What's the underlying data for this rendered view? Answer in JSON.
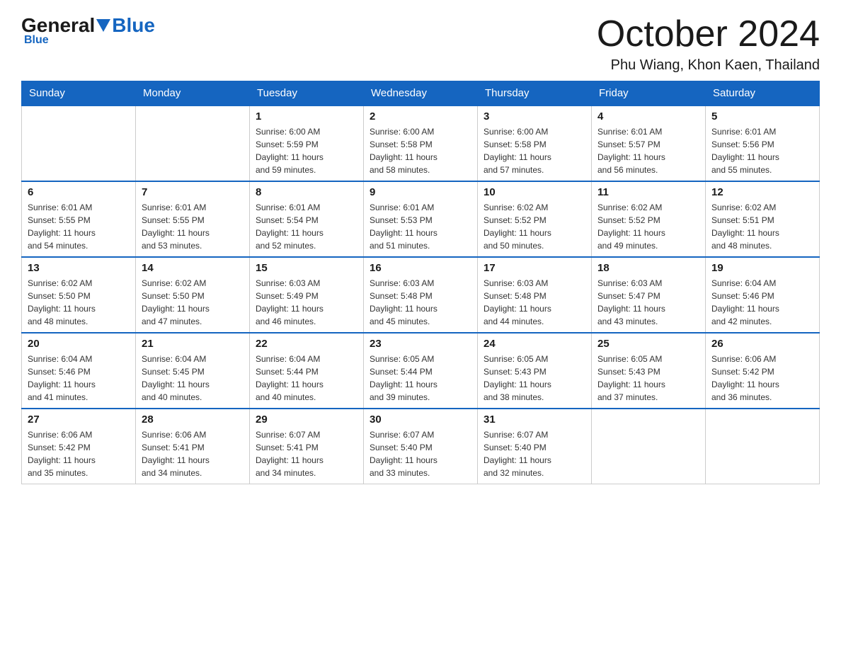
{
  "header": {
    "logo_general": "General",
    "logo_blue": "Blue",
    "title": "October 2024",
    "location": "Phu Wiang, Khon Kaen, Thailand"
  },
  "calendar": {
    "days_of_week": [
      "Sunday",
      "Monday",
      "Tuesday",
      "Wednesday",
      "Thursday",
      "Friday",
      "Saturday"
    ],
    "weeks": [
      [
        {
          "day": "",
          "info": ""
        },
        {
          "day": "",
          "info": ""
        },
        {
          "day": "1",
          "info": "Sunrise: 6:00 AM\nSunset: 5:59 PM\nDaylight: 11 hours\nand 59 minutes."
        },
        {
          "day": "2",
          "info": "Sunrise: 6:00 AM\nSunset: 5:58 PM\nDaylight: 11 hours\nand 58 minutes."
        },
        {
          "day": "3",
          "info": "Sunrise: 6:00 AM\nSunset: 5:58 PM\nDaylight: 11 hours\nand 57 minutes."
        },
        {
          "day": "4",
          "info": "Sunrise: 6:01 AM\nSunset: 5:57 PM\nDaylight: 11 hours\nand 56 minutes."
        },
        {
          "day": "5",
          "info": "Sunrise: 6:01 AM\nSunset: 5:56 PM\nDaylight: 11 hours\nand 55 minutes."
        }
      ],
      [
        {
          "day": "6",
          "info": "Sunrise: 6:01 AM\nSunset: 5:55 PM\nDaylight: 11 hours\nand 54 minutes."
        },
        {
          "day": "7",
          "info": "Sunrise: 6:01 AM\nSunset: 5:55 PM\nDaylight: 11 hours\nand 53 minutes."
        },
        {
          "day": "8",
          "info": "Sunrise: 6:01 AM\nSunset: 5:54 PM\nDaylight: 11 hours\nand 52 minutes."
        },
        {
          "day": "9",
          "info": "Sunrise: 6:01 AM\nSunset: 5:53 PM\nDaylight: 11 hours\nand 51 minutes."
        },
        {
          "day": "10",
          "info": "Sunrise: 6:02 AM\nSunset: 5:52 PM\nDaylight: 11 hours\nand 50 minutes."
        },
        {
          "day": "11",
          "info": "Sunrise: 6:02 AM\nSunset: 5:52 PM\nDaylight: 11 hours\nand 49 minutes."
        },
        {
          "day": "12",
          "info": "Sunrise: 6:02 AM\nSunset: 5:51 PM\nDaylight: 11 hours\nand 48 minutes."
        }
      ],
      [
        {
          "day": "13",
          "info": "Sunrise: 6:02 AM\nSunset: 5:50 PM\nDaylight: 11 hours\nand 48 minutes."
        },
        {
          "day": "14",
          "info": "Sunrise: 6:02 AM\nSunset: 5:50 PM\nDaylight: 11 hours\nand 47 minutes."
        },
        {
          "day": "15",
          "info": "Sunrise: 6:03 AM\nSunset: 5:49 PM\nDaylight: 11 hours\nand 46 minutes."
        },
        {
          "day": "16",
          "info": "Sunrise: 6:03 AM\nSunset: 5:48 PM\nDaylight: 11 hours\nand 45 minutes."
        },
        {
          "day": "17",
          "info": "Sunrise: 6:03 AM\nSunset: 5:48 PM\nDaylight: 11 hours\nand 44 minutes."
        },
        {
          "day": "18",
          "info": "Sunrise: 6:03 AM\nSunset: 5:47 PM\nDaylight: 11 hours\nand 43 minutes."
        },
        {
          "day": "19",
          "info": "Sunrise: 6:04 AM\nSunset: 5:46 PM\nDaylight: 11 hours\nand 42 minutes."
        }
      ],
      [
        {
          "day": "20",
          "info": "Sunrise: 6:04 AM\nSunset: 5:46 PM\nDaylight: 11 hours\nand 41 minutes."
        },
        {
          "day": "21",
          "info": "Sunrise: 6:04 AM\nSunset: 5:45 PM\nDaylight: 11 hours\nand 40 minutes."
        },
        {
          "day": "22",
          "info": "Sunrise: 6:04 AM\nSunset: 5:44 PM\nDaylight: 11 hours\nand 40 minutes."
        },
        {
          "day": "23",
          "info": "Sunrise: 6:05 AM\nSunset: 5:44 PM\nDaylight: 11 hours\nand 39 minutes."
        },
        {
          "day": "24",
          "info": "Sunrise: 6:05 AM\nSunset: 5:43 PM\nDaylight: 11 hours\nand 38 minutes."
        },
        {
          "day": "25",
          "info": "Sunrise: 6:05 AM\nSunset: 5:43 PM\nDaylight: 11 hours\nand 37 minutes."
        },
        {
          "day": "26",
          "info": "Sunrise: 6:06 AM\nSunset: 5:42 PM\nDaylight: 11 hours\nand 36 minutes."
        }
      ],
      [
        {
          "day": "27",
          "info": "Sunrise: 6:06 AM\nSunset: 5:42 PM\nDaylight: 11 hours\nand 35 minutes."
        },
        {
          "day": "28",
          "info": "Sunrise: 6:06 AM\nSunset: 5:41 PM\nDaylight: 11 hours\nand 34 minutes."
        },
        {
          "day": "29",
          "info": "Sunrise: 6:07 AM\nSunset: 5:41 PM\nDaylight: 11 hours\nand 34 minutes."
        },
        {
          "day": "30",
          "info": "Sunrise: 6:07 AM\nSunset: 5:40 PM\nDaylight: 11 hours\nand 33 minutes."
        },
        {
          "day": "31",
          "info": "Sunrise: 6:07 AM\nSunset: 5:40 PM\nDaylight: 11 hours\nand 32 minutes."
        },
        {
          "day": "",
          "info": ""
        },
        {
          "day": "",
          "info": ""
        }
      ]
    ]
  }
}
